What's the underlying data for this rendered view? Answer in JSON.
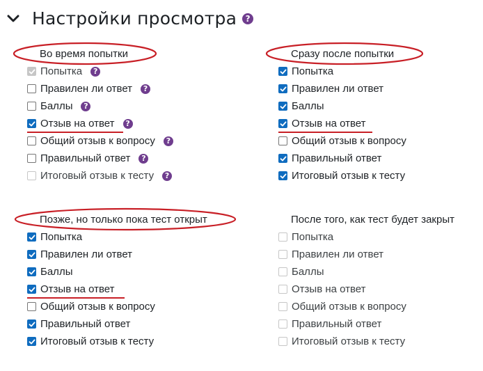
{
  "title": "Настройки просмотра",
  "colors": {
    "accent": "#0f6cbf",
    "help": "#6f3d8e",
    "annotation": "#c81f26"
  },
  "icons": {
    "collapse": "chevron-down-icon",
    "help": "question-circle-icon"
  },
  "groups": [
    {
      "title": "Во время попытки",
      "items": [
        {
          "label": "Попытка",
          "checked": true,
          "disabled": true,
          "help": true
        },
        {
          "label": "Правилен ли ответ",
          "checked": false,
          "disabled": false,
          "help": true
        },
        {
          "label": "Баллы",
          "checked": false,
          "disabled": false,
          "help": true
        },
        {
          "label": "Отзыв на ответ",
          "checked": true,
          "disabled": false,
          "help": true
        },
        {
          "label": "Общий отзыв к вопросу",
          "checked": false,
          "disabled": false,
          "help": true
        },
        {
          "label": "Правильный ответ",
          "checked": false,
          "disabled": false,
          "help": true
        },
        {
          "label": "Итоговый отзыв к тесту",
          "checked": false,
          "disabled": true,
          "help": true
        }
      ]
    },
    {
      "title": "Сразу после попытки",
      "items": [
        {
          "label": "Попытка",
          "checked": true,
          "disabled": false,
          "help": false
        },
        {
          "label": "Правилен ли ответ",
          "checked": true,
          "disabled": false,
          "help": false
        },
        {
          "label": "Баллы",
          "checked": true,
          "disabled": false,
          "help": false
        },
        {
          "label": "Отзыв на ответ",
          "checked": true,
          "disabled": false,
          "help": false
        },
        {
          "label": "Общий отзыв к вопросу",
          "checked": false,
          "disabled": false,
          "help": false
        },
        {
          "label": "Правильный ответ",
          "checked": true,
          "disabled": false,
          "help": false
        },
        {
          "label": "Итоговый отзыв к тесту",
          "checked": true,
          "disabled": false,
          "help": false
        }
      ]
    },
    {
      "title": "Позже, но только пока тест открыт",
      "items": [
        {
          "label": "Попытка",
          "checked": true,
          "disabled": false,
          "help": false
        },
        {
          "label": "Правилен ли ответ",
          "checked": true,
          "disabled": false,
          "help": false
        },
        {
          "label": "Баллы",
          "checked": true,
          "disabled": false,
          "help": false
        },
        {
          "label": "Отзыв на ответ",
          "checked": true,
          "disabled": false,
          "help": false
        },
        {
          "label": "Общий отзыв к вопросу",
          "checked": false,
          "disabled": false,
          "help": false
        },
        {
          "label": "Правильный ответ",
          "checked": true,
          "disabled": false,
          "help": false
        },
        {
          "label": "Итоговый отзыв к тесту",
          "checked": true,
          "disabled": false,
          "help": false
        }
      ]
    },
    {
      "title": "После того, как тест будет закрыт",
      "items": [
        {
          "label": "Попытка",
          "checked": false,
          "disabled": true,
          "help": false
        },
        {
          "label": "Правилен ли ответ",
          "checked": false,
          "disabled": true,
          "help": false
        },
        {
          "label": "Баллы",
          "checked": false,
          "disabled": true,
          "help": false
        },
        {
          "label": "Отзыв на ответ",
          "checked": false,
          "disabled": true,
          "help": false
        },
        {
          "label": "Общий отзыв к вопросу",
          "checked": false,
          "disabled": true,
          "help": false
        },
        {
          "label": "Правильный ответ",
          "checked": false,
          "disabled": true,
          "help": false
        },
        {
          "label": "Итоговый отзыв к тесту",
          "checked": false,
          "disabled": true,
          "help": false
        }
      ]
    }
  ]
}
